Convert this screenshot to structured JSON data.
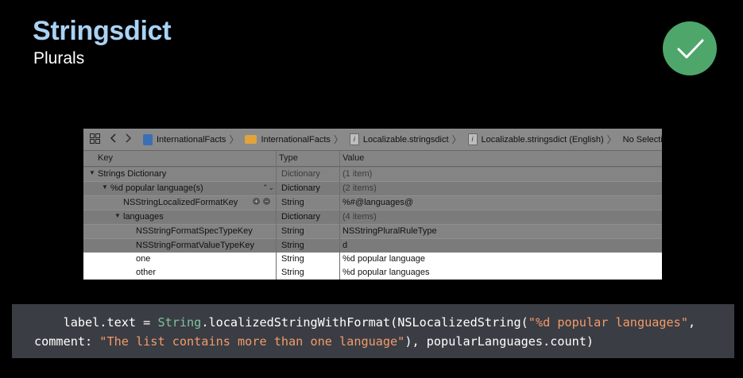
{
  "slide": {
    "title": "Stringsdict",
    "subtitle": "Plurals",
    "badge_icon": "checkmark-icon",
    "badge_color": "#4ea66b"
  },
  "jumpbar": {
    "crumbs": [
      "InternationalFacts",
      "InternationalFacts",
      "Localizable.stringsdict",
      "Localizable.stringsdict (English)",
      "No Selection"
    ]
  },
  "columns": {
    "key": "Key",
    "type": "Type",
    "value": "Value"
  },
  "rows": [
    {
      "key": "Strings Dictionary",
      "type": "Dictionary",
      "value": "(1 item)"
    },
    {
      "key": "%d popular language(s)",
      "type": "Dictionary",
      "value": "(2 items)"
    },
    {
      "key": "NSStringLocalizedFormatKey",
      "type": "String",
      "value": "%#@languages@"
    },
    {
      "key": "languages",
      "type": "Dictionary",
      "value": "(4 items)"
    },
    {
      "key": "NSStringFormatSpecTypeKey",
      "type": "String",
      "value": "NSStringPluralRuleType"
    },
    {
      "key": "NSStringFormatValueTypeKey",
      "type": "String",
      "value": "d"
    },
    {
      "key": "one",
      "type": "String",
      "value": "%d popular language"
    },
    {
      "key": "other",
      "type": "String",
      "value": "%d popular languages"
    }
  ],
  "code": {
    "l1_indent": "    ",
    "l1_a": "label.text = ",
    "l1_type": "String",
    "l1_b": ".localizedStringWithFormat(NSLocalizedString(",
    "l1_str": "\"%d popular languages\"",
    "l1_c": ",",
    "l2_a": "comment: ",
    "l2_str": "\"The list contains more than one language\"",
    "l2_b": "), popularLanguages.count)"
  }
}
